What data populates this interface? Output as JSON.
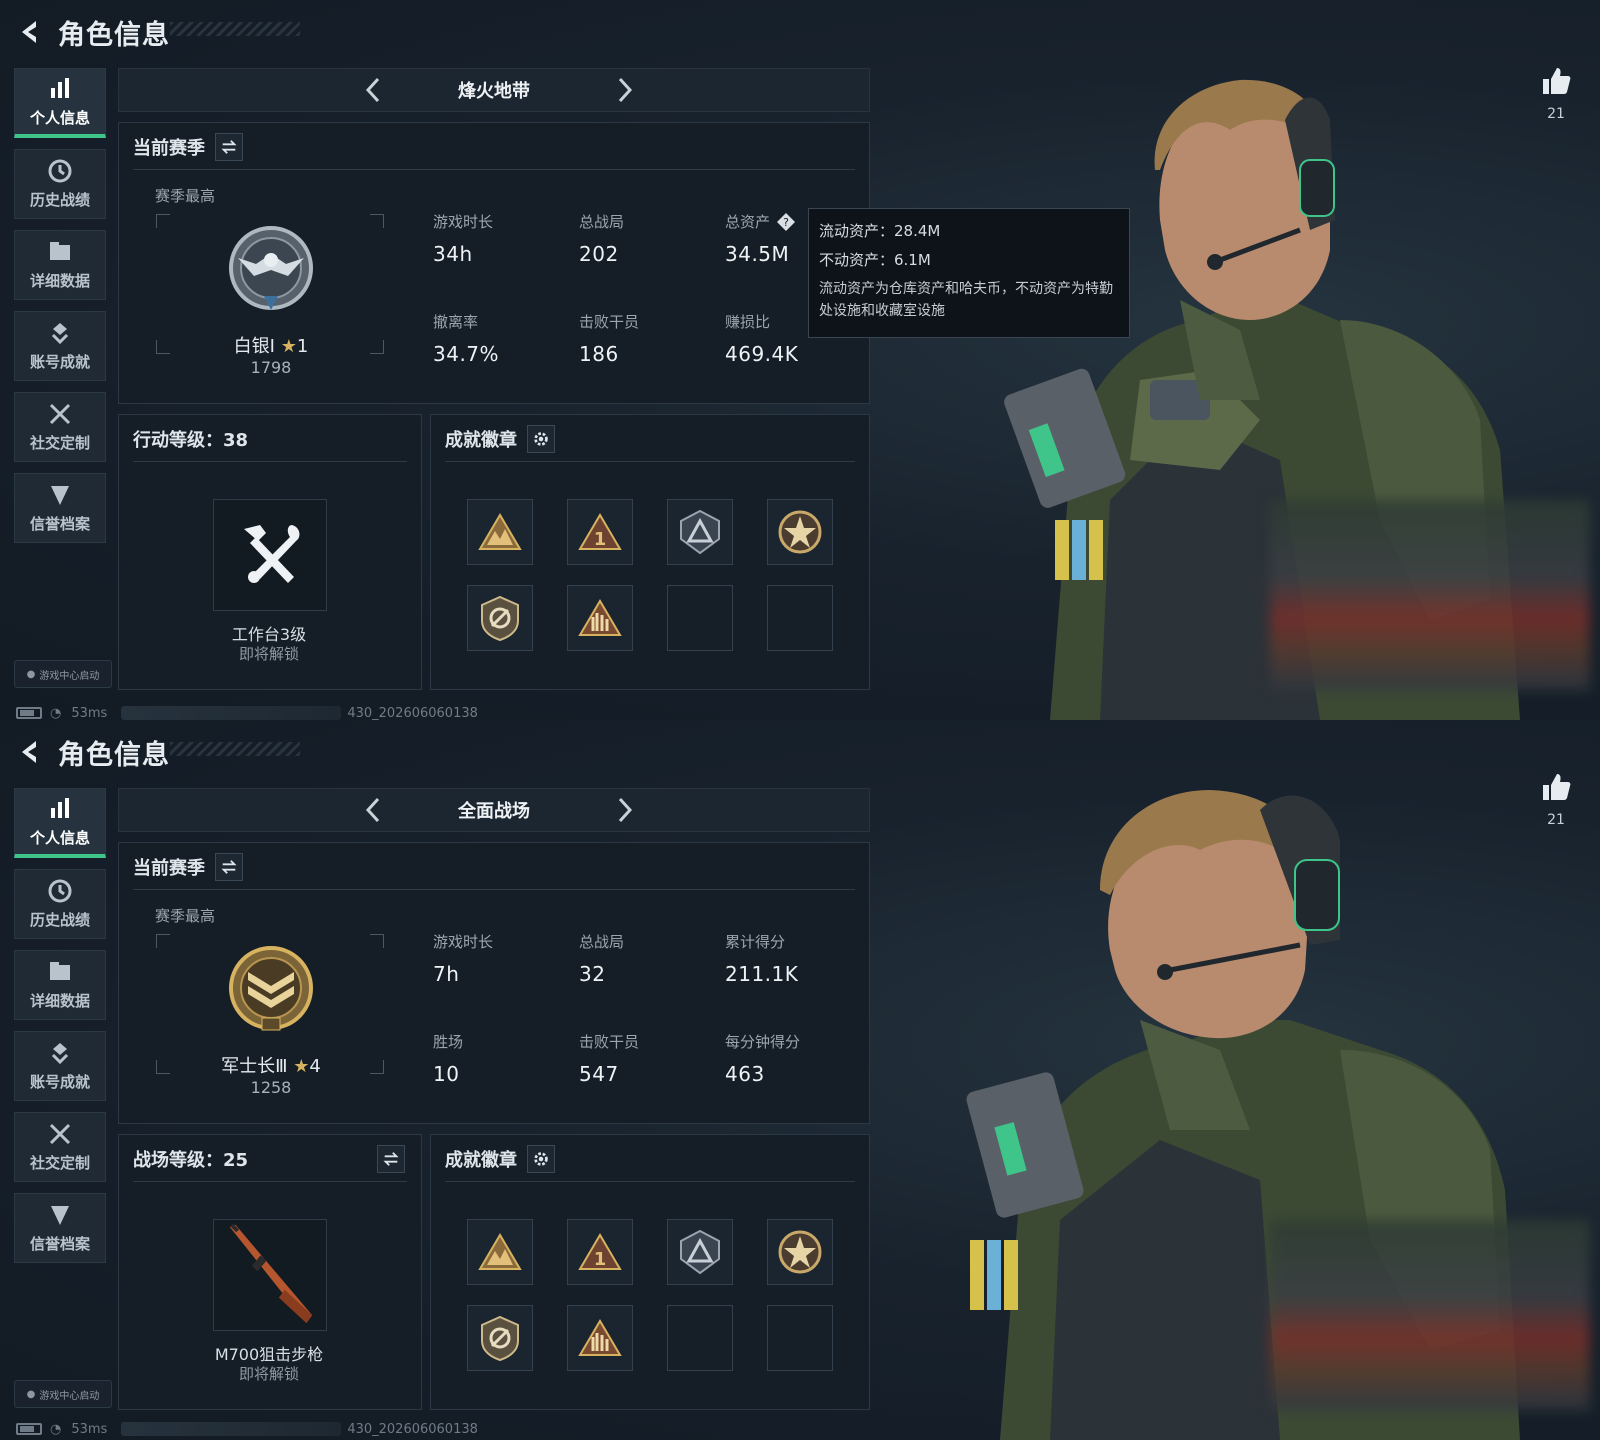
{
  "screens": [
    {
      "title": "角色信息",
      "sidebar": [
        "个人信息",
        "历史战绩",
        "详细数据",
        "账号成就",
        "社交定制",
        "信誉档案"
      ],
      "launch_label": "游戏中心启动",
      "status": {
        "ping": "53ms",
        "build": "430_202606060138"
      },
      "mode": "烽火地带",
      "season": {
        "label": "当前赛季",
        "sub": "赛季最高",
        "rank_name": "白银Ⅰ",
        "rank_stars": "1",
        "rank_score": "1798",
        "stats": [
          {
            "label": "游戏时长",
            "value": "34h"
          },
          {
            "label": "总战局",
            "value": "202"
          },
          {
            "label": "总资产",
            "value": "34.5M"
          },
          {
            "label": "撤离率",
            "value": "34.7%"
          },
          {
            "label": "击败干员",
            "value": "186"
          },
          {
            "label": "赚损比",
            "value": "469.4K"
          }
        ]
      },
      "tooltip": {
        "line1": "流动资产：28.4M",
        "line2": "不动资产：6.1M",
        "desc": "流动资产为仓库资产和哈夫币，不动资产为特勤处设施和收藏室设施"
      },
      "level": {
        "title": "行动等级：38",
        "item": "工作台3级",
        "sub": "即将解锁"
      },
      "achievements": {
        "title": "成就徽章"
      },
      "likes": "21"
    },
    {
      "title": "角色信息",
      "sidebar": [
        "个人信息",
        "历史战绩",
        "详细数据",
        "账号成就",
        "社交定制",
        "信誉档案"
      ],
      "launch_label": "游戏中心启动",
      "status": {
        "ping": "53ms",
        "build": "430_202606060138"
      },
      "mode": "全面战场",
      "season": {
        "label": "当前赛季",
        "sub": "赛季最高",
        "rank_name": "军士长Ⅲ",
        "rank_stars": "4",
        "rank_score": "1258",
        "stats": [
          {
            "label": "游戏时长",
            "value": "7h"
          },
          {
            "label": "总战局",
            "value": "32"
          },
          {
            "label": "累计得分",
            "value": "211.1K"
          },
          {
            "label": "胜场",
            "value": "10"
          },
          {
            "label": "击败干员",
            "value": "547"
          },
          {
            "label": "每分钟得分",
            "value": "463"
          }
        ]
      },
      "level": {
        "title": "战场等级：25",
        "item": "M700狙击步枪",
        "sub": "即将解锁"
      },
      "achievements": {
        "title": "成就徽章"
      },
      "likes": "21"
    }
  ],
  "colors": {
    "accent_green": "#3fc48a",
    "gold": "#d7b35f",
    "panel": "#151e27"
  },
  "icons": [
    "back-arrow-icon",
    "bar-chart-icon",
    "history-clock-icon",
    "folder-icon",
    "trophy-icon",
    "tools-icon",
    "shield-icon",
    "swap-icon",
    "gear-icon",
    "question-icon",
    "thumbs-up-icon",
    "hammer-wrench-icon",
    "sniper-rifle-icon"
  ]
}
